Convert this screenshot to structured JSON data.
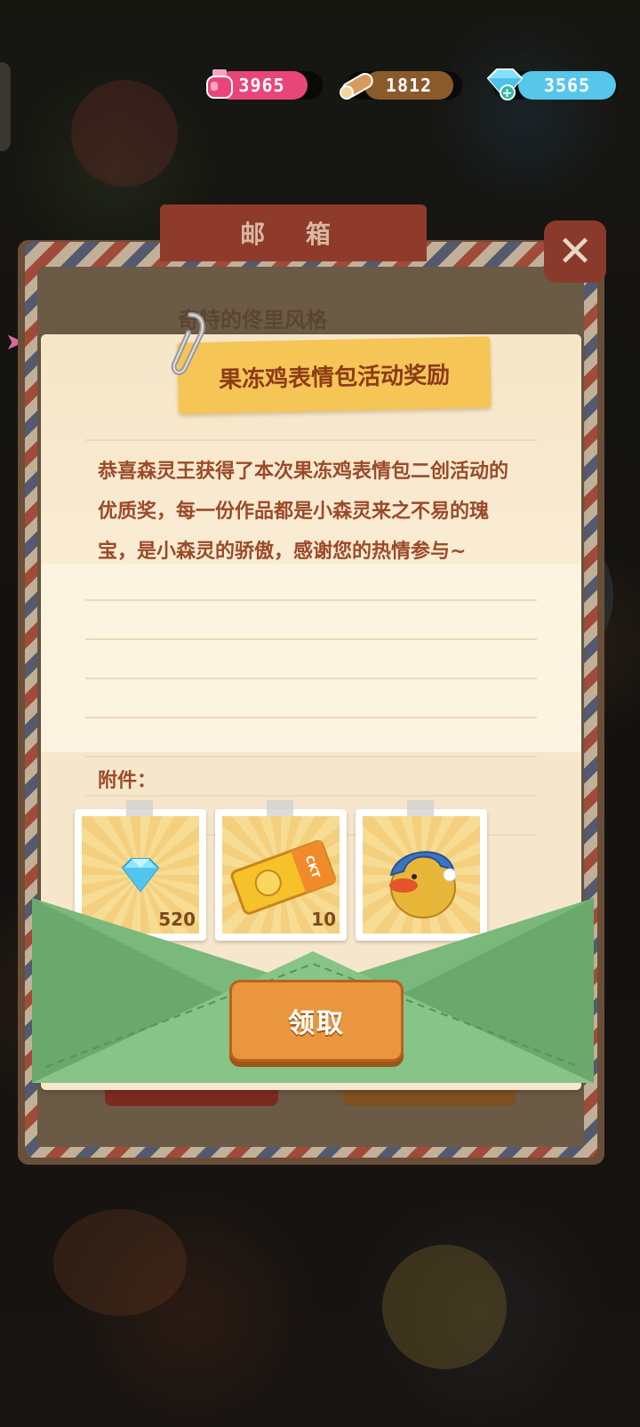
{
  "resources": {
    "ink": {
      "value": "3965",
      "icon": "ink-bottle-icon",
      "color": "#e8467a"
    },
    "wood": {
      "value": "1812",
      "icon": "wood-log-icon",
      "color": "#8b5a2b"
    },
    "gems": {
      "value": "3565",
      "icon": "diamond-plus-icon",
      "color": "#56c6ea"
    }
  },
  "mailbox": {
    "title": "邮 箱",
    "behind_item_title": "奇特的佟里风格",
    "close_icon": "close-icon"
  },
  "letter": {
    "title": "果冻鸡表情包活动奖励",
    "body": "恭喜森灵王获得了本次果冻鸡表情包二创活动的优质奖，每一份作品都是小森灵来之不易的瑰宝，是小森灵的骄傲，感谢您的热情参与~",
    "attachments_label": "附件："
  },
  "attachments": [
    {
      "name": "diamond",
      "icon": "diamond-icon",
      "quantity": "520"
    },
    {
      "name": "ckt-ticket",
      "icon": "ticket-icon",
      "quantity": "10",
      "ticket_text": "CKT"
    },
    {
      "name": "jelly-chick-avatar",
      "icon": "jelly-chick-icon",
      "quantity": ""
    }
  ],
  "actions": {
    "claim_label": "领取"
  }
}
